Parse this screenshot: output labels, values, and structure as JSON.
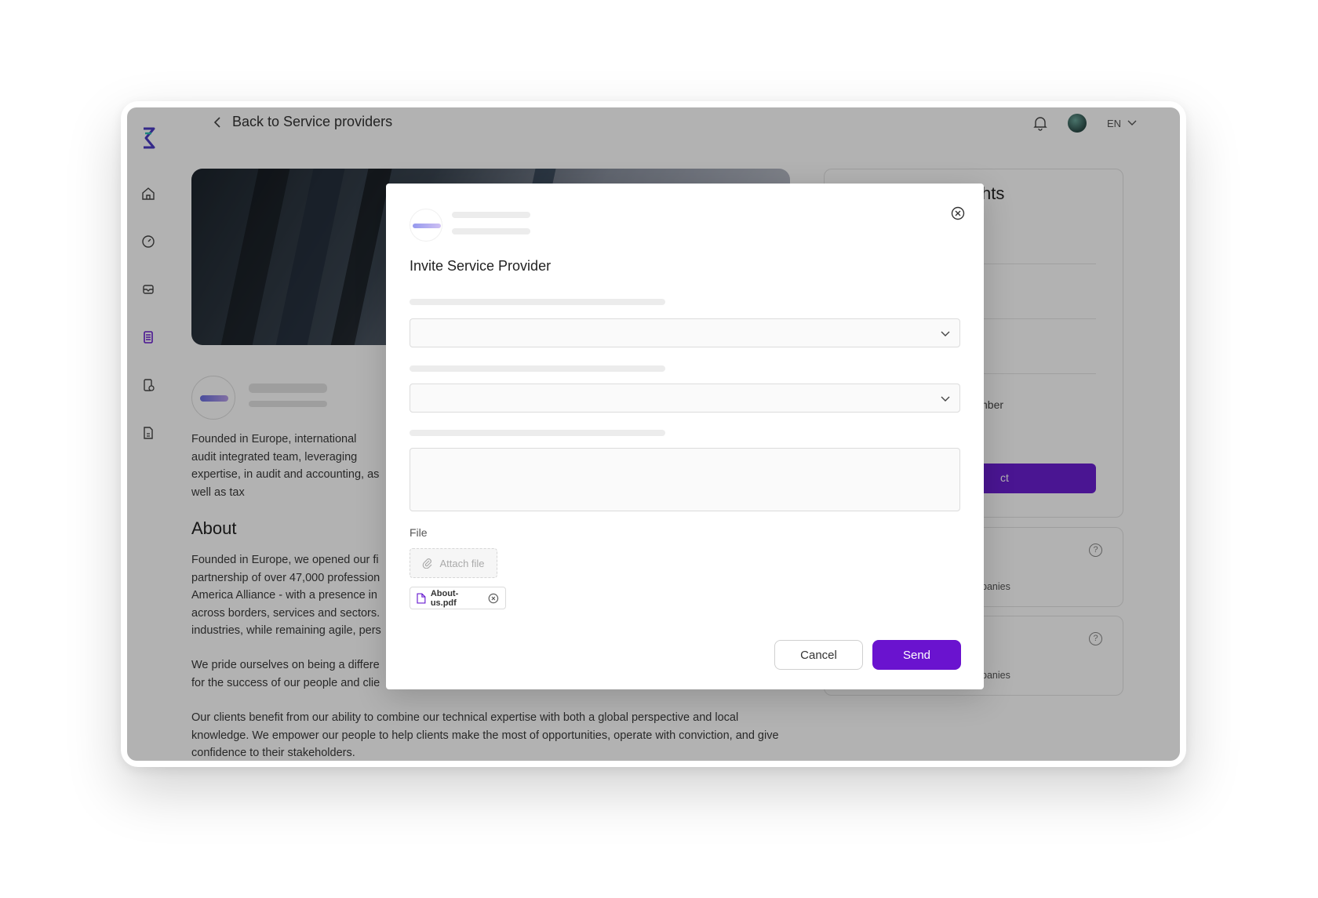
{
  "header": {
    "back_label": "Back to Service providers",
    "language": "EN"
  },
  "company": {
    "intro": "Founded in Europe, international audit integrated team, leveraging expertise, in audit and accounting, as well as tax",
    "about_title": "About",
    "about_p1": "Founded in Europe, we opened our fi partnership of over 47,000 profession America Alliance - with a presence in across borders, services and sectors. industries, while remaining agile, pers",
    "about_p2": "We pride ourselves on being a differe for the success of our people and clie",
    "about_p3": "Our clients benefit from our ability to combine our technical expertise with both a global perspective and local knowledge. We empower our people to help clients make the most of opportunities, operate with conviction, and give confidence to their stakeholders."
  },
  "right_panel": {
    "title_partial": "hts",
    "field_partial": "nber",
    "button_partial": "ct",
    "card1_partial": "panies",
    "card2_partial": "panies"
  },
  "modal": {
    "title": "Invite Service Provider",
    "file_label": "File",
    "attach_label": "Attach file",
    "attached_file": "About-us.pdf",
    "cancel_label": "Cancel",
    "send_label": "Send"
  },
  "colors": {
    "accent": "#6a13cf"
  }
}
